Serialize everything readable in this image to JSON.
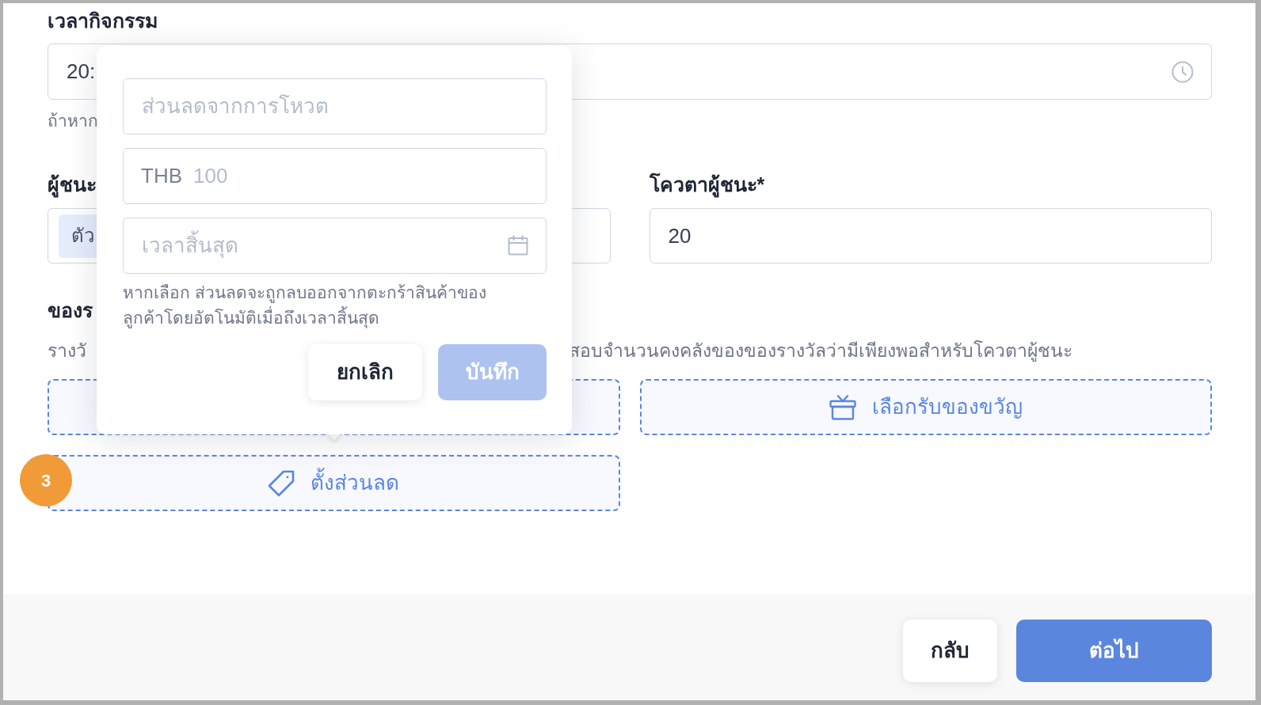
{
  "activity_time": {
    "label": "เวลากิจกรรม",
    "value": "20:",
    "helper": "ถ้าหาก"
  },
  "winners": {
    "label": "ผู้ชนะ",
    "tags": [
      "ตัว"
    ]
  },
  "winner_quota": {
    "label": "โควตาผู้ชนะ*",
    "value": "20"
  },
  "prizes": {
    "label": "ของร",
    "description": [
      "รางวั",
      "สอบจำนวนคงคลังของของรางวัลว่ามีเพียงพอสำหรับโควตาผู้ชนะ"
    ],
    "options": [
      {
        "kind": "blank"
      },
      {
        "kind": "gift",
        "label": "เลือกรับของขวัญ"
      },
      {
        "kind": "tag",
        "label": "ตั้งส่วนลด",
        "step": "3"
      }
    ]
  },
  "discount_popover": {
    "fields": [
      {
        "kind": "text",
        "placeholder": "ส่วนลดจากการโหวต"
      },
      {
        "kind": "amount",
        "prefix": "THB",
        "placeholder": "100"
      },
      {
        "kind": "date",
        "placeholder": "เวลาสิ้นสุด"
      }
    ],
    "note": "หากเลือก ส่วนลดจะถูกลบออกจากตะกร้าสินค้าของลูกค้าโดยอัตโนมัติเมื่อถึงเวลาสิ้นสุด",
    "buttons": [
      {
        "kind": "secondary",
        "label": "ยกเลิก",
        "disabled": false
      },
      {
        "kind": "primary",
        "label": "บันทึก",
        "disabled": true
      }
    ]
  },
  "footer": {
    "buttons": [
      {
        "kind": "secondary",
        "label": "กลับ"
      },
      {
        "kind": "primary",
        "label": "ต่อไป"
      }
    ]
  }
}
